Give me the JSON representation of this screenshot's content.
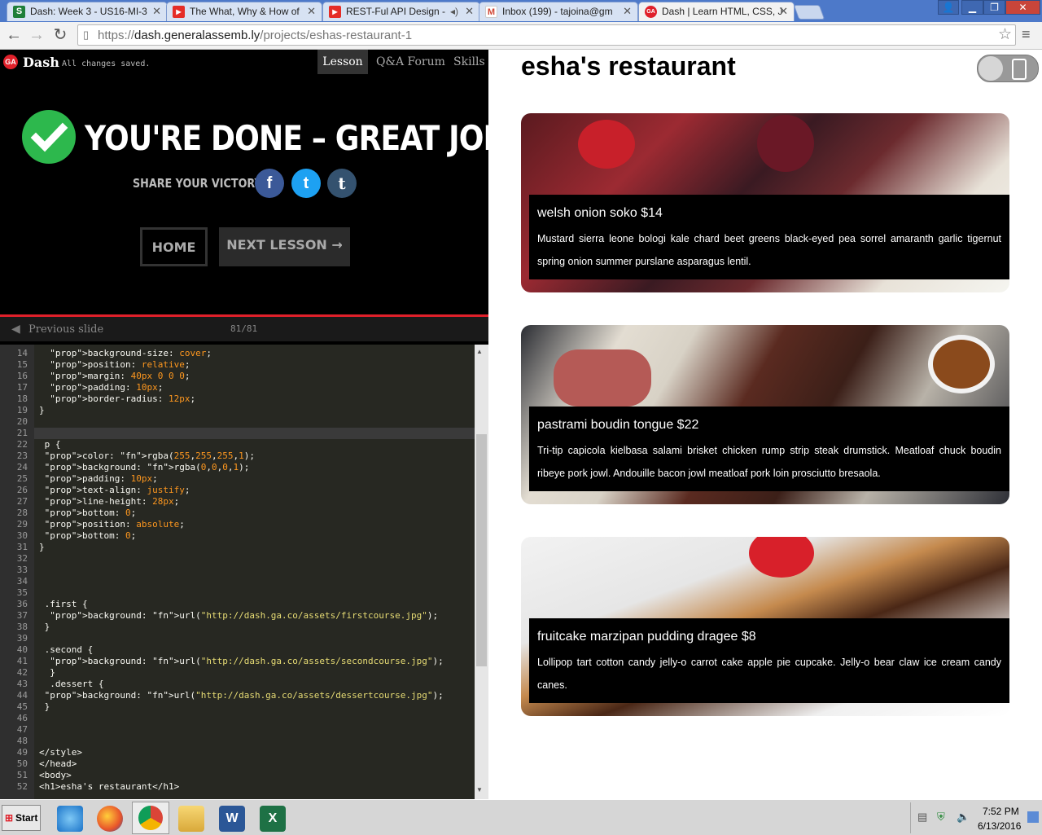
{
  "browser": {
    "tabs": [
      {
        "label": "Dash: Week 3 - US16-MI-3",
        "favicon": "S",
        "favicon_color": "#1f7f3a"
      },
      {
        "label": "The What, Why & How of",
        "favicon": "▶",
        "favicon_color": "#e52d27"
      },
      {
        "label": "REST-Ful API Design -",
        "favicon": "▶",
        "favicon_color": "#e52d27"
      },
      {
        "label": "Inbox (199) - tajoina@gm",
        "favicon": "M",
        "favicon_color": "#d14836"
      },
      {
        "label": "Dash | Learn HTML, CSS, J",
        "favicon": "GA",
        "favicon_color": "#e0202a"
      }
    ],
    "url_scheme": "https://",
    "url_host": "dash.generalassemb.ly",
    "url_path": "/projects/eshas-restaurant-1"
  },
  "dash": {
    "logo": "GA",
    "app_name": "Dash",
    "save_status": "All changes saved.",
    "nav": [
      "Lesson",
      "Q&A Forum",
      "Skills"
    ],
    "done_title": "YOU'RE DONE – GREAT JOB!",
    "share_label": "SHARE YOUR VICTORY:",
    "share_icons": [
      "f",
      "t",
      "t"
    ],
    "home_button": "HOME",
    "next_button": "NEXT LESSON →",
    "previous_slide": "Previous slide",
    "slide_count": "81/81"
  },
  "editor": {
    "lines": [
      {
        "n": "14",
        "text": "  background-size: cover;"
      },
      {
        "n": "15",
        "text": "  position: relative;"
      },
      {
        "n": "16",
        "text": "  margin: 40px 0 0 0;"
      },
      {
        "n": "17",
        "text": "  padding: 10px;"
      },
      {
        "n": "18",
        "text": "  border-radius: 12px;"
      },
      {
        "n": "19",
        "text": "}"
      },
      {
        "n": "20",
        "text": ""
      },
      {
        "n": "21",
        "text": ""
      },
      {
        "n": "22",
        "text": " p {"
      },
      {
        "n": "23",
        "text": " color: rgba(255,255,255,1);"
      },
      {
        "n": "24",
        "text": " background: rgba(0,0,0,1);"
      },
      {
        "n": "25",
        "text": " padding: 10px;"
      },
      {
        "n": "26",
        "text": " text-align: justify;"
      },
      {
        "n": "27",
        "text": " line-height: 28px;"
      },
      {
        "n": "28",
        "text": " bottom: 0;"
      },
      {
        "n": "29",
        "text": " position: absolute;"
      },
      {
        "n": "30",
        "text": " bottom: 0;"
      },
      {
        "n": "31",
        "text": "}"
      },
      {
        "n": "32",
        "text": ""
      },
      {
        "n": "33",
        "text": ""
      },
      {
        "n": "34",
        "text": ""
      },
      {
        "n": "35",
        "text": ""
      },
      {
        "n": "36",
        "text": " .first {"
      },
      {
        "n": "37",
        "text": "  background: url(\"http://dash.ga.co/assets/firstcourse.jpg\");"
      },
      {
        "n": "38",
        "text": " }"
      },
      {
        "n": "39",
        "text": ""
      },
      {
        "n": "40",
        "text": " .second {"
      },
      {
        "n": "41",
        "text": "  background: url(\"http://dash.ga.co/assets/secondcourse.jpg\");"
      },
      {
        "n": "42",
        "text": "  }"
      },
      {
        "n": "43",
        "text": "  .dessert {"
      },
      {
        "n": "44",
        "text": " background: url(\"http://dash.ga.co/assets/dessertcourse.jpg\");"
      },
      {
        "n": "45",
        "text": " }"
      },
      {
        "n": "46",
        "text": ""
      },
      {
        "n": "47",
        "text": ""
      },
      {
        "n": "48",
        "text": ""
      },
      {
        "n": "49",
        "text": "</style>"
      },
      {
        "n": "50",
        "text": "</head>"
      },
      {
        "n": "51",
        "text": "<body>"
      },
      {
        "n": "52",
        "text": "<h1>esha's restaurant</h1>"
      }
    ]
  },
  "preview": {
    "title": "esha's restaurant",
    "cards": [
      {
        "heading": "welsh onion soko $14",
        "text": "Mustard sierra leone bologi kale chard beet greens black-eyed pea sorrel amaranth garlic tigernut spring onion summer purslane asparagus lentil."
      },
      {
        "heading": "pastrami boudin tongue $22",
        "text": "Tri-tip capicola kielbasa salami brisket chicken rump strip steak drumstick. Meatloaf chuck boudin ribeye pork jowl. Andouille bacon jowl meatloaf pork loin prosciutto bresaola."
      },
      {
        "heading": "fruitcake marzipan pudding dragee $8",
        "text": "Lollipop tart cotton candy jelly-o carrot cake apple pie cupcake. Jelly-o bear claw ice cream candy canes."
      }
    ]
  },
  "taskbar": {
    "start": "Start",
    "time": "7:52 PM",
    "date": "6/13/2016"
  }
}
